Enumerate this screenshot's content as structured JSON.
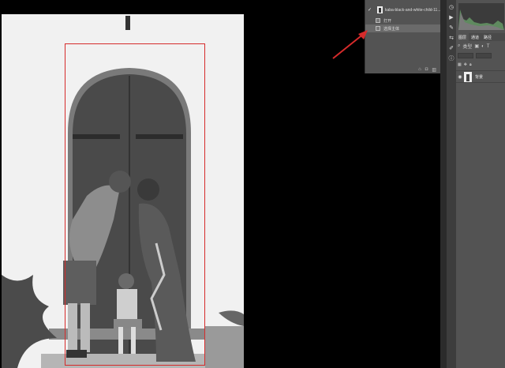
{
  "history": {
    "snapshot_label": "kaba-black-and-white-child-11...",
    "states": [
      "打开",
      "选择主体"
    ],
    "footer_icons": [
      "new-snapshot-icon",
      "camera-icon",
      "trash-icon"
    ]
  },
  "right_panel": {
    "tabs": [
      "图层",
      "通道",
      "路径"
    ],
    "kind_label": "类型",
    "layer_name": "背景"
  },
  "colors": {
    "selection": "#d62b2b",
    "arrow": "#d62b2b",
    "panel_bg": "#535353"
  }
}
